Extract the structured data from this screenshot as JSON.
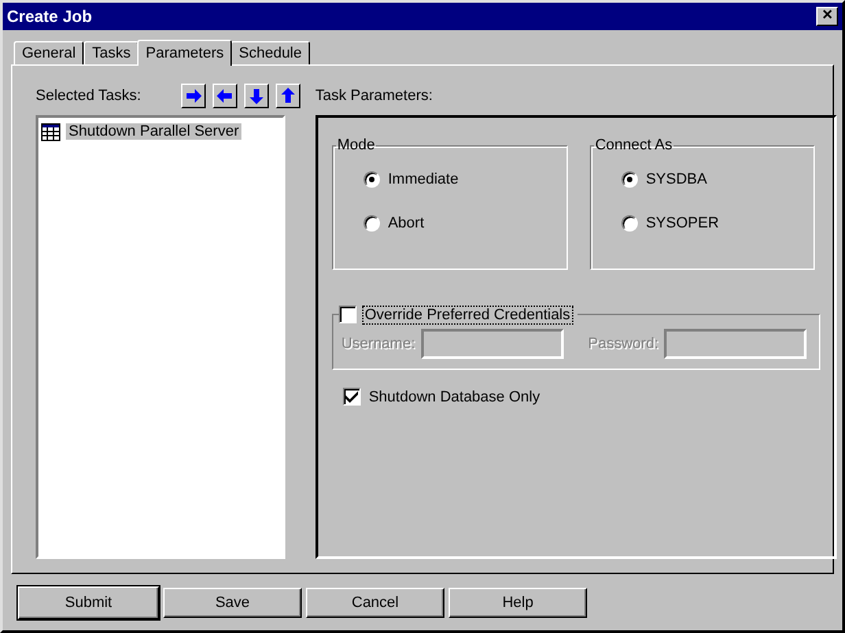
{
  "window": {
    "title": "Create Job",
    "close": "✕"
  },
  "tabs": [
    {
      "label": "General",
      "selected": false
    },
    {
      "label": "Tasks",
      "selected": false
    },
    {
      "label": "Parameters",
      "selected": true
    },
    {
      "label": "Schedule",
      "selected": false
    }
  ],
  "selected_tasks": {
    "label": "Selected Tasks:",
    "items": [
      {
        "label": "Shutdown Parallel Server",
        "selected": true
      }
    ]
  },
  "task_parameters": {
    "label": "Task Parameters:",
    "mode": {
      "title": "Mode",
      "options": [
        {
          "label": "Immediate",
          "selected": true
        },
        {
          "label": "Abort",
          "selected": false
        }
      ]
    },
    "connect_as": {
      "title": "Connect As",
      "options": [
        {
          "label": "SYSDBA",
          "selected": true
        },
        {
          "label": "SYSOPER",
          "selected": false
        }
      ]
    },
    "credentials": {
      "label": "Override Preferred Credentials",
      "checked": false,
      "username_label": "Username:",
      "password_label": "Password:"
    },
    "shutdown_db_only": {
      "label": "Shutdown Database Only",
      "checked": true
    }
  },
  "buttons": [
    {
      "label": "Submit",
      "default": true
    },
    {
      "label": "Save",
      "default": false
    },
    {
      "label": "Cancel",
      "default": false
    },
    {
      "label": "Help",
      "default": false
    }
  ]
}
